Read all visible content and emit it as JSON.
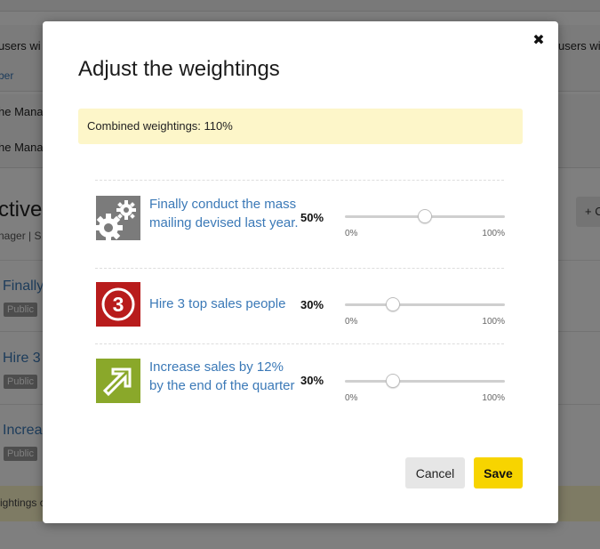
{
  "background": {
    "row1": "users wi",
    "row1_right": "users wit",
    "row1_link": "ber",
    "row2": "he Mana",
    "row3": "he Mana",
    "heading": "ctives",
    "subline": "nager | S",
    "add_button": "+ C",
    "items": [
      {
        "title": "Finally",
        "badge": "Public"
      },
      {
        "title": "Hire 3",
        "badge": "Public"
      },
      {
        "title": "Increa",
        "badge": "Public"
      }
    ],
    "notice": "ightings co"
  },
  "modal": {
    "title": "Adjust the weightings",
    "combined_label": "Combined weightings: 110%",
    "goals": [
      {
        "title": "Finally conduct the mass mailing devised last year.",
        "percent_label": "50%",
        "value": 50,
        "icon": "gears-icon",
        "icon_color": "#7b7b7b",
        "min_label": "0%",
        "max_label": "100%"
      },
      {
        "title": "Hire 3 top sales people",
        "percent_label": "30%",
        "value": 30,
        "icon": "number-three-icon",
        "icon_color": "#b81c1c",
        "icon_text": "3",
        "min_label": "0%",
        "max_label": "100%"
      },
      {
        "title": "Increase sales by 12% by the end of the quarter",
        "percent_label": "30%",
        "value": 30,
        "icon": "arrow-up-right-icon",
        "icon_color": "#8aa82a",
        "min_label": "0%",
        "max_label": "100%"
      }
    ],
    "cancel_label": "Cancel",
    "save_label": "Save"
  },
  "colors": {
    "link": "#3b79b7",
    "highlight": "#fdf6c9",
    "save_button": "#f7d400",
    "cancel_button": "#e6e6e6"
  }
}
